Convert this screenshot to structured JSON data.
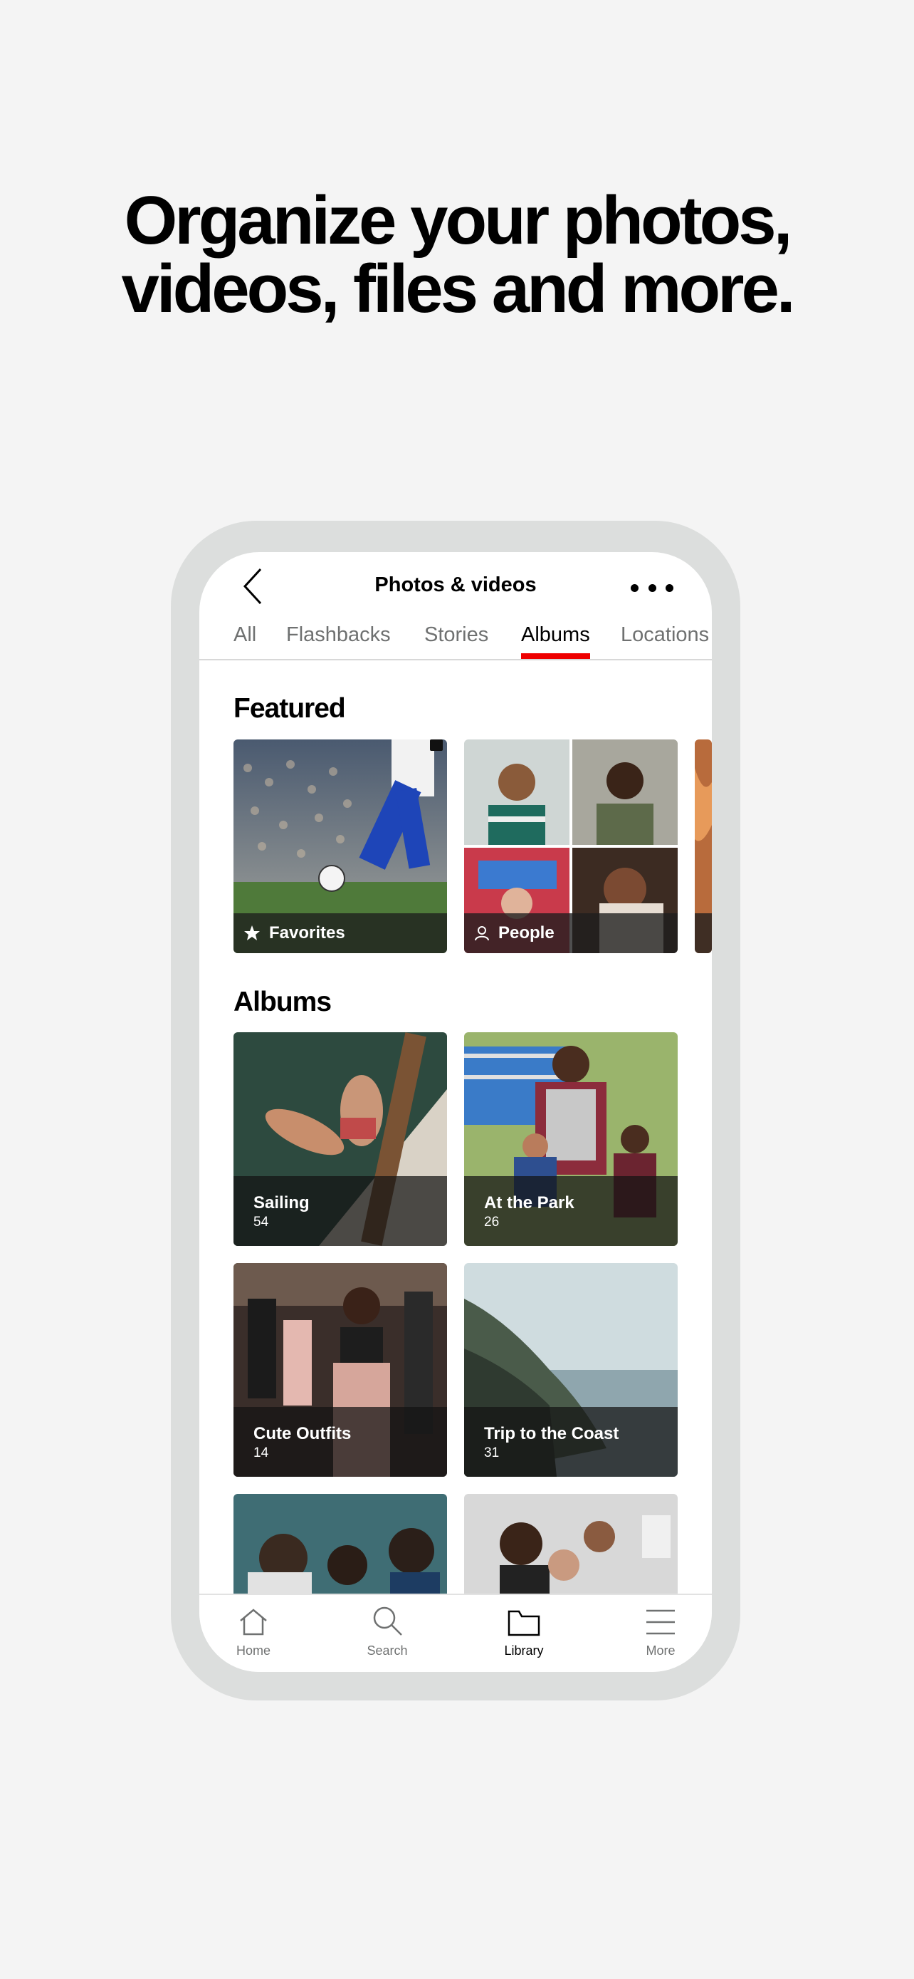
{
  "headline": {
    "line1": "Organize your photos,",
    "line2": "videos, files and more."
  },
  "app": {
    "title": "Photos & videos",
    "back_icon": "chevron-left-icon",
    "more_icon": "more-dots-icon"
  },
  "tabs": [
    {
      "label": "All",
      "active": false
    },
    {
      "label": "Flashbacks",
      "active": false
    },
    {
      "label": "Stories",
      "active": false
    },
    {
      "label": "Albums",
      "active": true
    },
    {
      "label": "Locations",
      "active": false
    }
  ],
  "featured": {
    "title": "Featured",
    "items": [
      {
        "label": "Favorites",
        "icon": "star-icon"
      },
      {
        "label": "People",
        "icon": "person-icon"
      }
    ]
  },
  "albums": {
    "title": "Albums",
    "items": [
      {
        "name": "Sailing",
        "count": "54"
      },
      {
        "name": "At the Park",
        "count": "26"
      },
      {
        "name": "Cute Outfits",
        "count": "14"
      },
      {
        "name": "Trip to the Coast",
        "count": "31"
      }
    ]
  },
  "bottom_nav": [
    {
      "label": "Home",
      "icon": "home-icon",
      "active": false
    },
    {
      "label": "Search",
      "icon": "search-icon",
      "active": false
    },
    {
      "label": "Library",
      "icon": "folder-icon",
      "active": true
    },
    {
      "label": "More",
      "icon": "menu-icon",
      "active": false
    }
  ],
  "colors": {
    "accent": "#ee0000",
    "frame": "#dcdedd",
    "background": "#f4f4f4"
  }
}
